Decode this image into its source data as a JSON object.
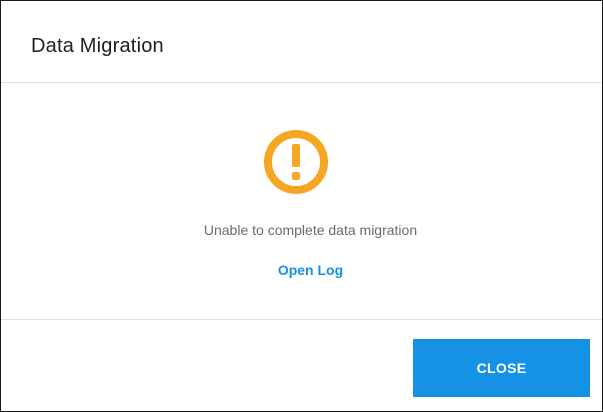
{
  "dialog": {
    "title": "Data Migration",
    "icon": "warning-exclamation-icon",
    "message": "Unable to complete data migration",
    "open_log_label": "Open Log",
    "close_label": "CLOSE"
  },
  "colors": {
    "warning": "#f5a623",
    "accent": "#1592e6",
    "title_text": "#1f1f1f",
    "message_text": "#6b6b6b",
    "divider": "#e0e0e0",
    "border": "#1a1a1a"
  }
}
